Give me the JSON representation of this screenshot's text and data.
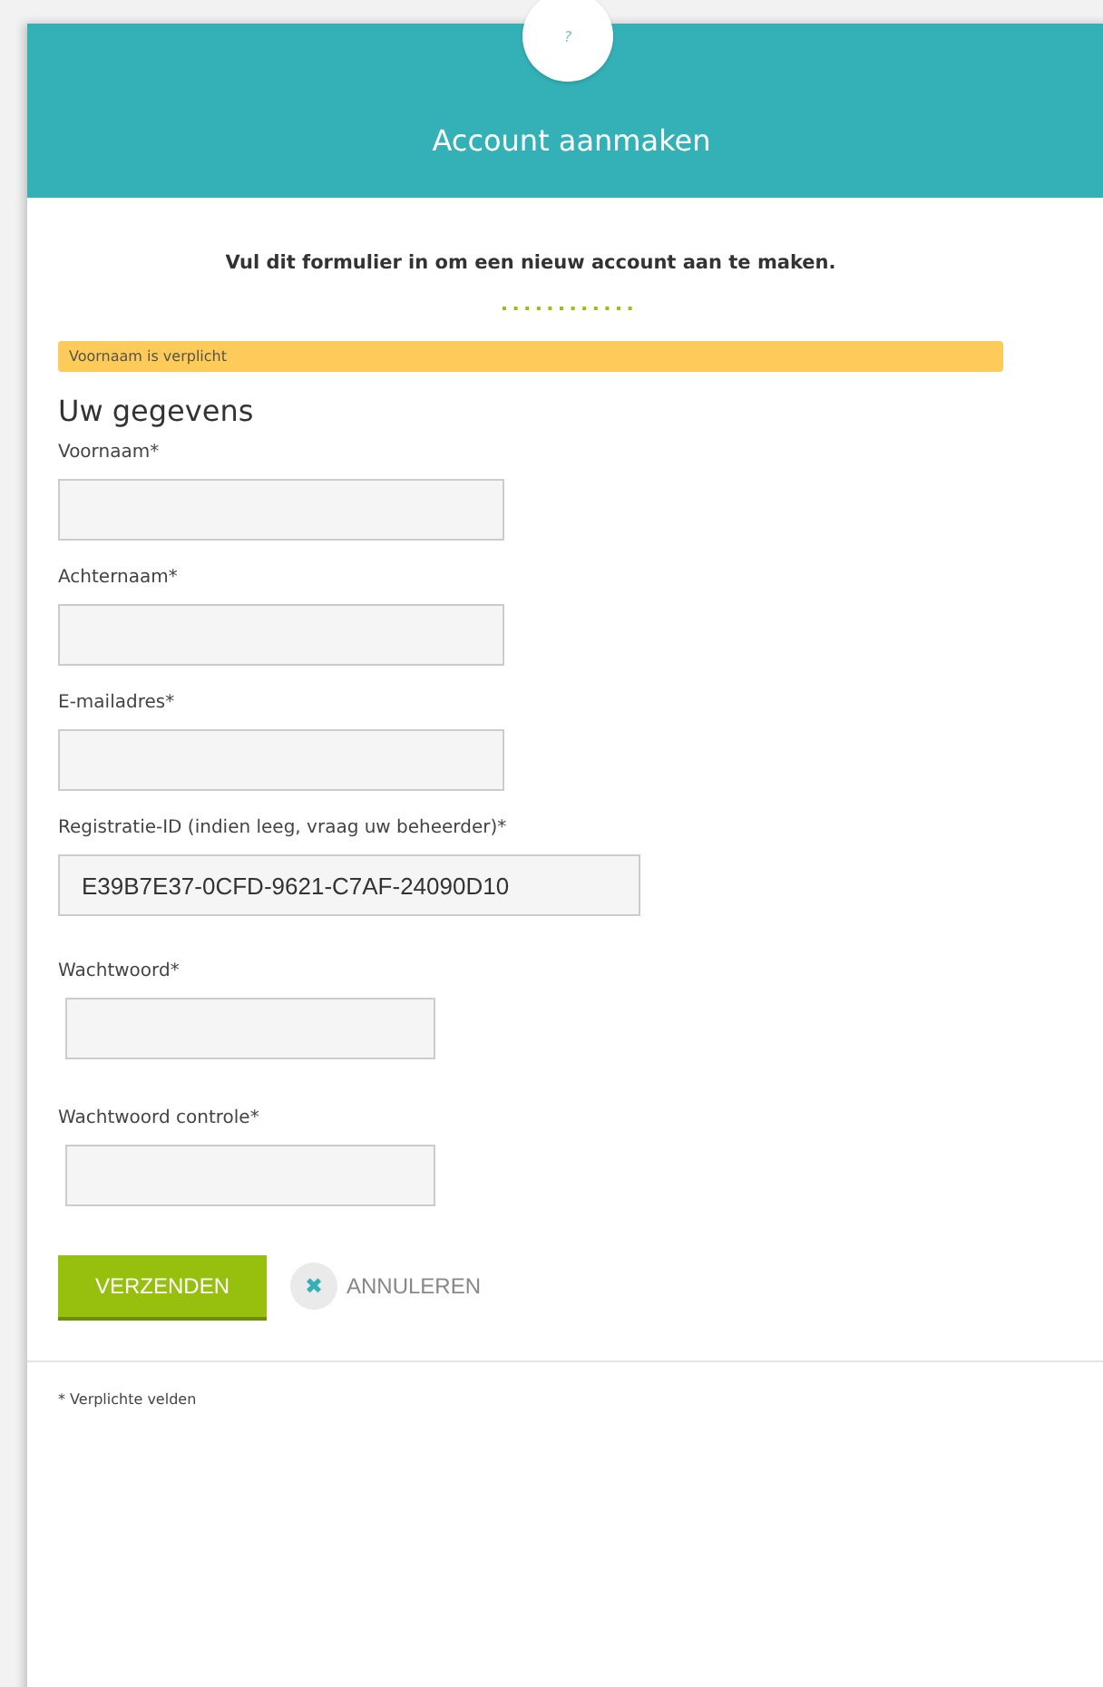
{
  "help_badge": "?",
  "header": {
    "title": "Account aanmaken"
  },
  "intro": "Vul dit formulier in om een nieuw account aan te maken.",
  "alert": "Voornaam is verplicht",
  "section_title": "Uw gegevens",
  "fields": [
    {
      "label": "Voornaam*",
      "kind": "text"
    },
    {
      "label": "Achternaam*",
      "kind": "text"
    },
    {
      "label": "E-mailadres*",
      "kind": "text"
    },
    {
      "label": "Registratie-ID (indien leeg, vraag uw beheerder)*",
      "kind": "id",
      "value": "E39B7E37-0CFD-9621-C7AF-24090D10"
    },
    {
      "label": "Wachtwoord*",
      "kind": "password"
    },
    {
      "label": "Wachtwoord controle*",
      "kind": "password"
    }
  ],
  "submit": "VERZENDEN",
  "cancel": {
    "icon": "✖",
    "label": "ANNULEREN"
  },
  "footnote": "* Verplichte velden"
}
